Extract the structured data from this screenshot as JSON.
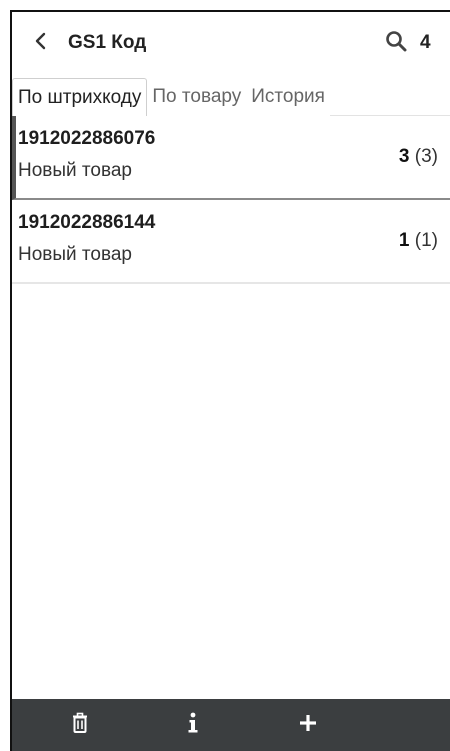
{
  "header": {
    "title": "GS1 Код",
    "count": "4",
    "back_icon": "chevron-left-icon",
    "search_icon": "search-icon"
  },
  "tabs": [
    {
      "label": "По штрихкоду",
      "active": true
    },
    {
      "label": "По товару",
      "active": false
    },
    {
      "label": "История",
      "active": false
    }
  ],
  "items": [
    {
      "barcode": "1912022886076",
      "name": "Новый товар",
      "qty": "3",
      "qty_total": "(3)",
      "selected": true
    },
    {
      "barcode": "1912022886144",
      "name": "Новый товар",
      "qty": "1",
      "qty_total": "(1)",
      "selected": false
    }
  ],
  "bottom_bar": {
    "background": "#3b3e40",
    "buttons": [
      {
        "icon": "trash-icon"
      },
      {
        "icon": "info-icon"
      },
      {
        "icon": "plus-icon"
      }
    ]
  }
}
